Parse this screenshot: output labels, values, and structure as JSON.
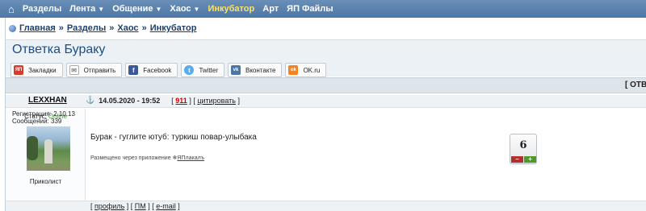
{
  "nav": {
    "items": [
      "Разделы",
      "Лента",
      "Общение",
      "Хаос",
      "Инкубатор",
      "Арт",
      "ЯП Файлы"
    ]
  },
  "breadcrumb": {
    "items": [
      "Главная",
      "Разделы",
      "Хаос",
      "Инкубатор"
    ],
    "sep": "»"
  },
  "page": {
    "title": "Ответка Бураку"
  },
  "share": [
    {
      "label": "Закладки",
      "icon": "ЯП",
      "color": "#d63b2f"
    },
    {
      "label": "Отправить",
      "icon": "✉",
      "color": "#8a8a8a"
    },
    {
      "label": "Facebook",
      "icon": "f",
      "color": "#3b5998"
    },
    {
      "label": "Twitter",
      "icon": "t",
      "color": "#55acee"
    },
    {
      "label": "Вконтакте",
      "icon": "vk",
      "color": "#4c75a3"
    },
    {
      "label": "OK.ru",
      "icon": "ok",
      "color": "#f58220"
    }
  ],
  "reply_bar": {
    "label": "[ ОТВ"
  },
  "post": {
    "author": "LEXXHAN",
    "datetime": "14.05.2020 - 19:52",
    "number": "911",
    "quote": "цитировать",
    "status_label": "Статус:",
    "status_value": "Online",
    "role": "Приколист",
    "reg_label": "Регистрация:",
    "reg_value": "2.10.13",
    "msgs_label": "Сообщений:",
    "msgs_value": "339",
    "body": "Бурак - гуглите ютуб: туркиш повар-улыбака",
    "via_text": "Размещено через приложение",
    "via_link": "ЯПлакалъ",
    "rating": "6",
    "rating_minus": "–",
    "rating_plus": "+",
    "links": [
      "профиль",
      "ПМ",
      "e-mail"
    ]
  }
}
